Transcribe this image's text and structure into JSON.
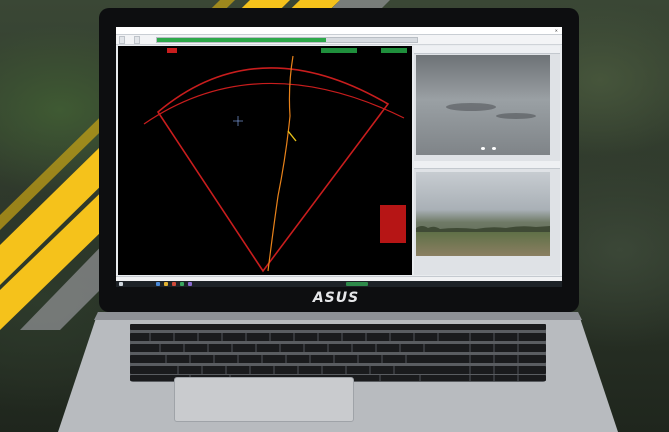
{
  "scene": {
    "description_tag": "laptop-running-radar-software",
    "background_colors": {
      "camo_dark": "#2f3a2c",
      "camo_light": "#46553b",
      "stripe_yellow": "#f5c21b",
      "stripe_gray": "#8d8f92"
    }
  },
  "laptop": {
    "brand_logo": "ASUS"
  },
  "software": {
    "title": "",
    "toolbar": {
      "buttons": [
        "",
        ""
      ]
    },
    "progress_fraction": 0.65,
    "radar": {
      "info_text": "",
      "track_color": "#e8821a",
      "sector_color": "#c81d1d",
      "alarm_lines": [
        "",
        "",
        "",
        "",
        ""
      ]
    },
    "camera_panels": [
      {
        "label": "",
        "view": "sky-grayscale"
      },
      {
        "label": "",
        "view": "field-color"
      }
    ],
    "status": "",
    "taskbar_time": ""
  }
}
